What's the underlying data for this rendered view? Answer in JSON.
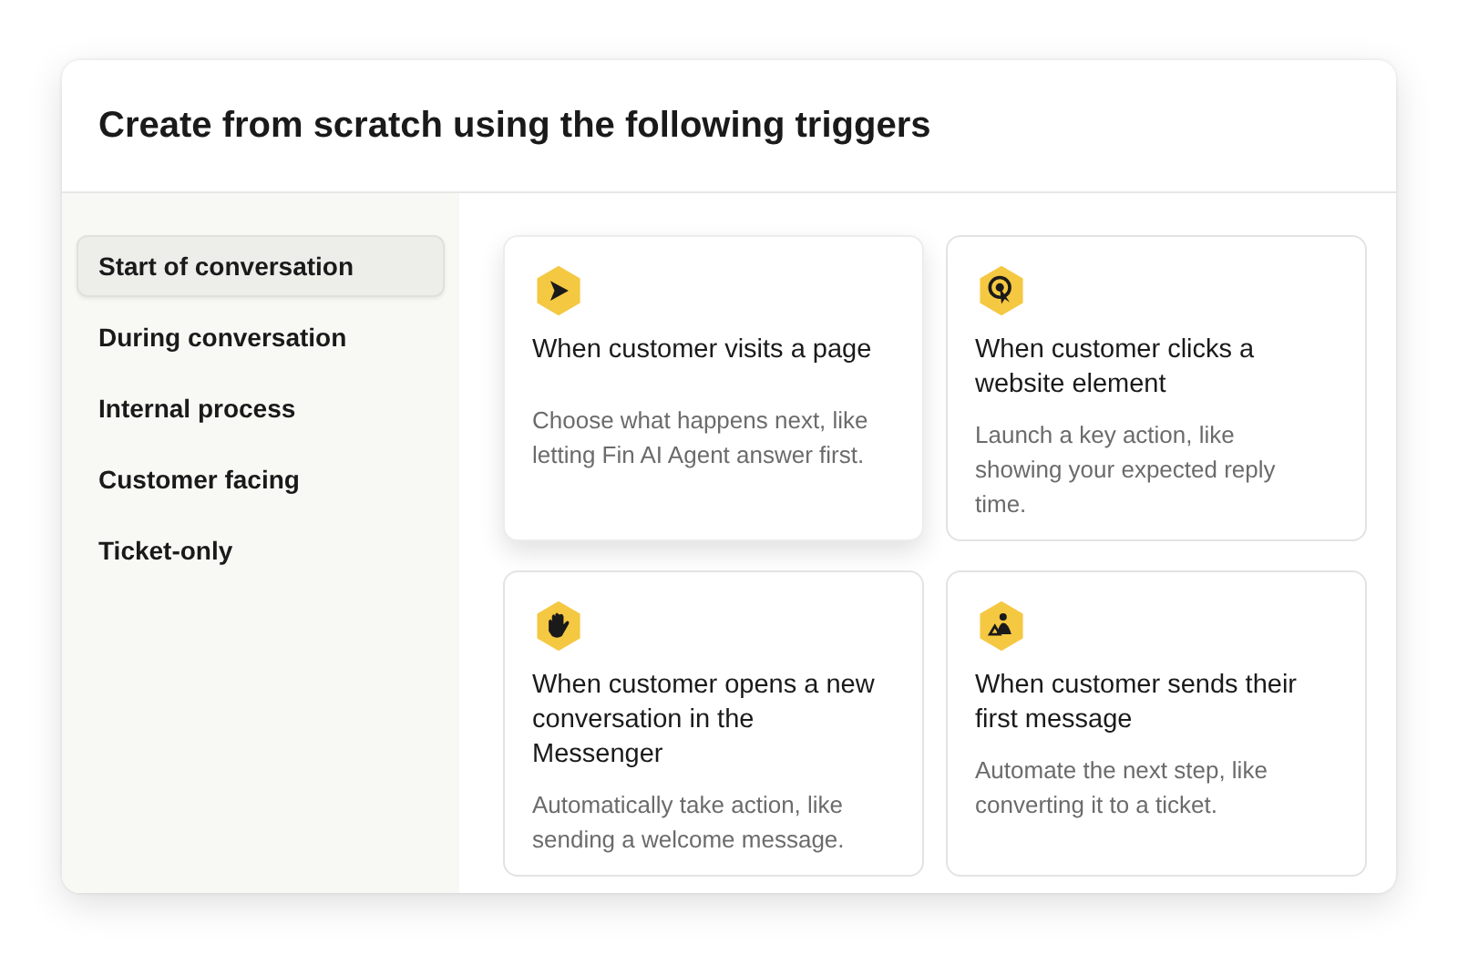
{
  "dialog": {
    "title": "Create from scratch using the following triggers"
  },
  "sidebar": {
    "items": [
      {
        "label": "Start of conversation",
        "selected": true
      },
      {
        "label": "During conversation",
        "selected": false
      },
      {
        "label": "Internal process",
        "selected": false
      },
      {
        "label": "Customer facing",
        "selected": false
      },
      {
        "label": "Ticket-only",
        "selected": false
      }
    ]
  },
  "cards": [
    {
      "title": "When customer visits a page",
      "description": "Choose what happens next, like letting Fin AI Agent answer first.",
      "selected": true
    },
    {
      "title": "When customer clicks a website element",
      "description": "Launch a key action, like showing your expected reply time.",
      "selected": false
    },
    {
      "title": "When customer opens a new conversation in the Messenger",
      "description": "Automatically take action, like sending a welcome message.",
      "selected": false
    },
    {
      "title": "When customer sends their first message",
      "description": "Automate the next step, like converting it to a ticket.",
      "selected": false
    }
  ]
}
